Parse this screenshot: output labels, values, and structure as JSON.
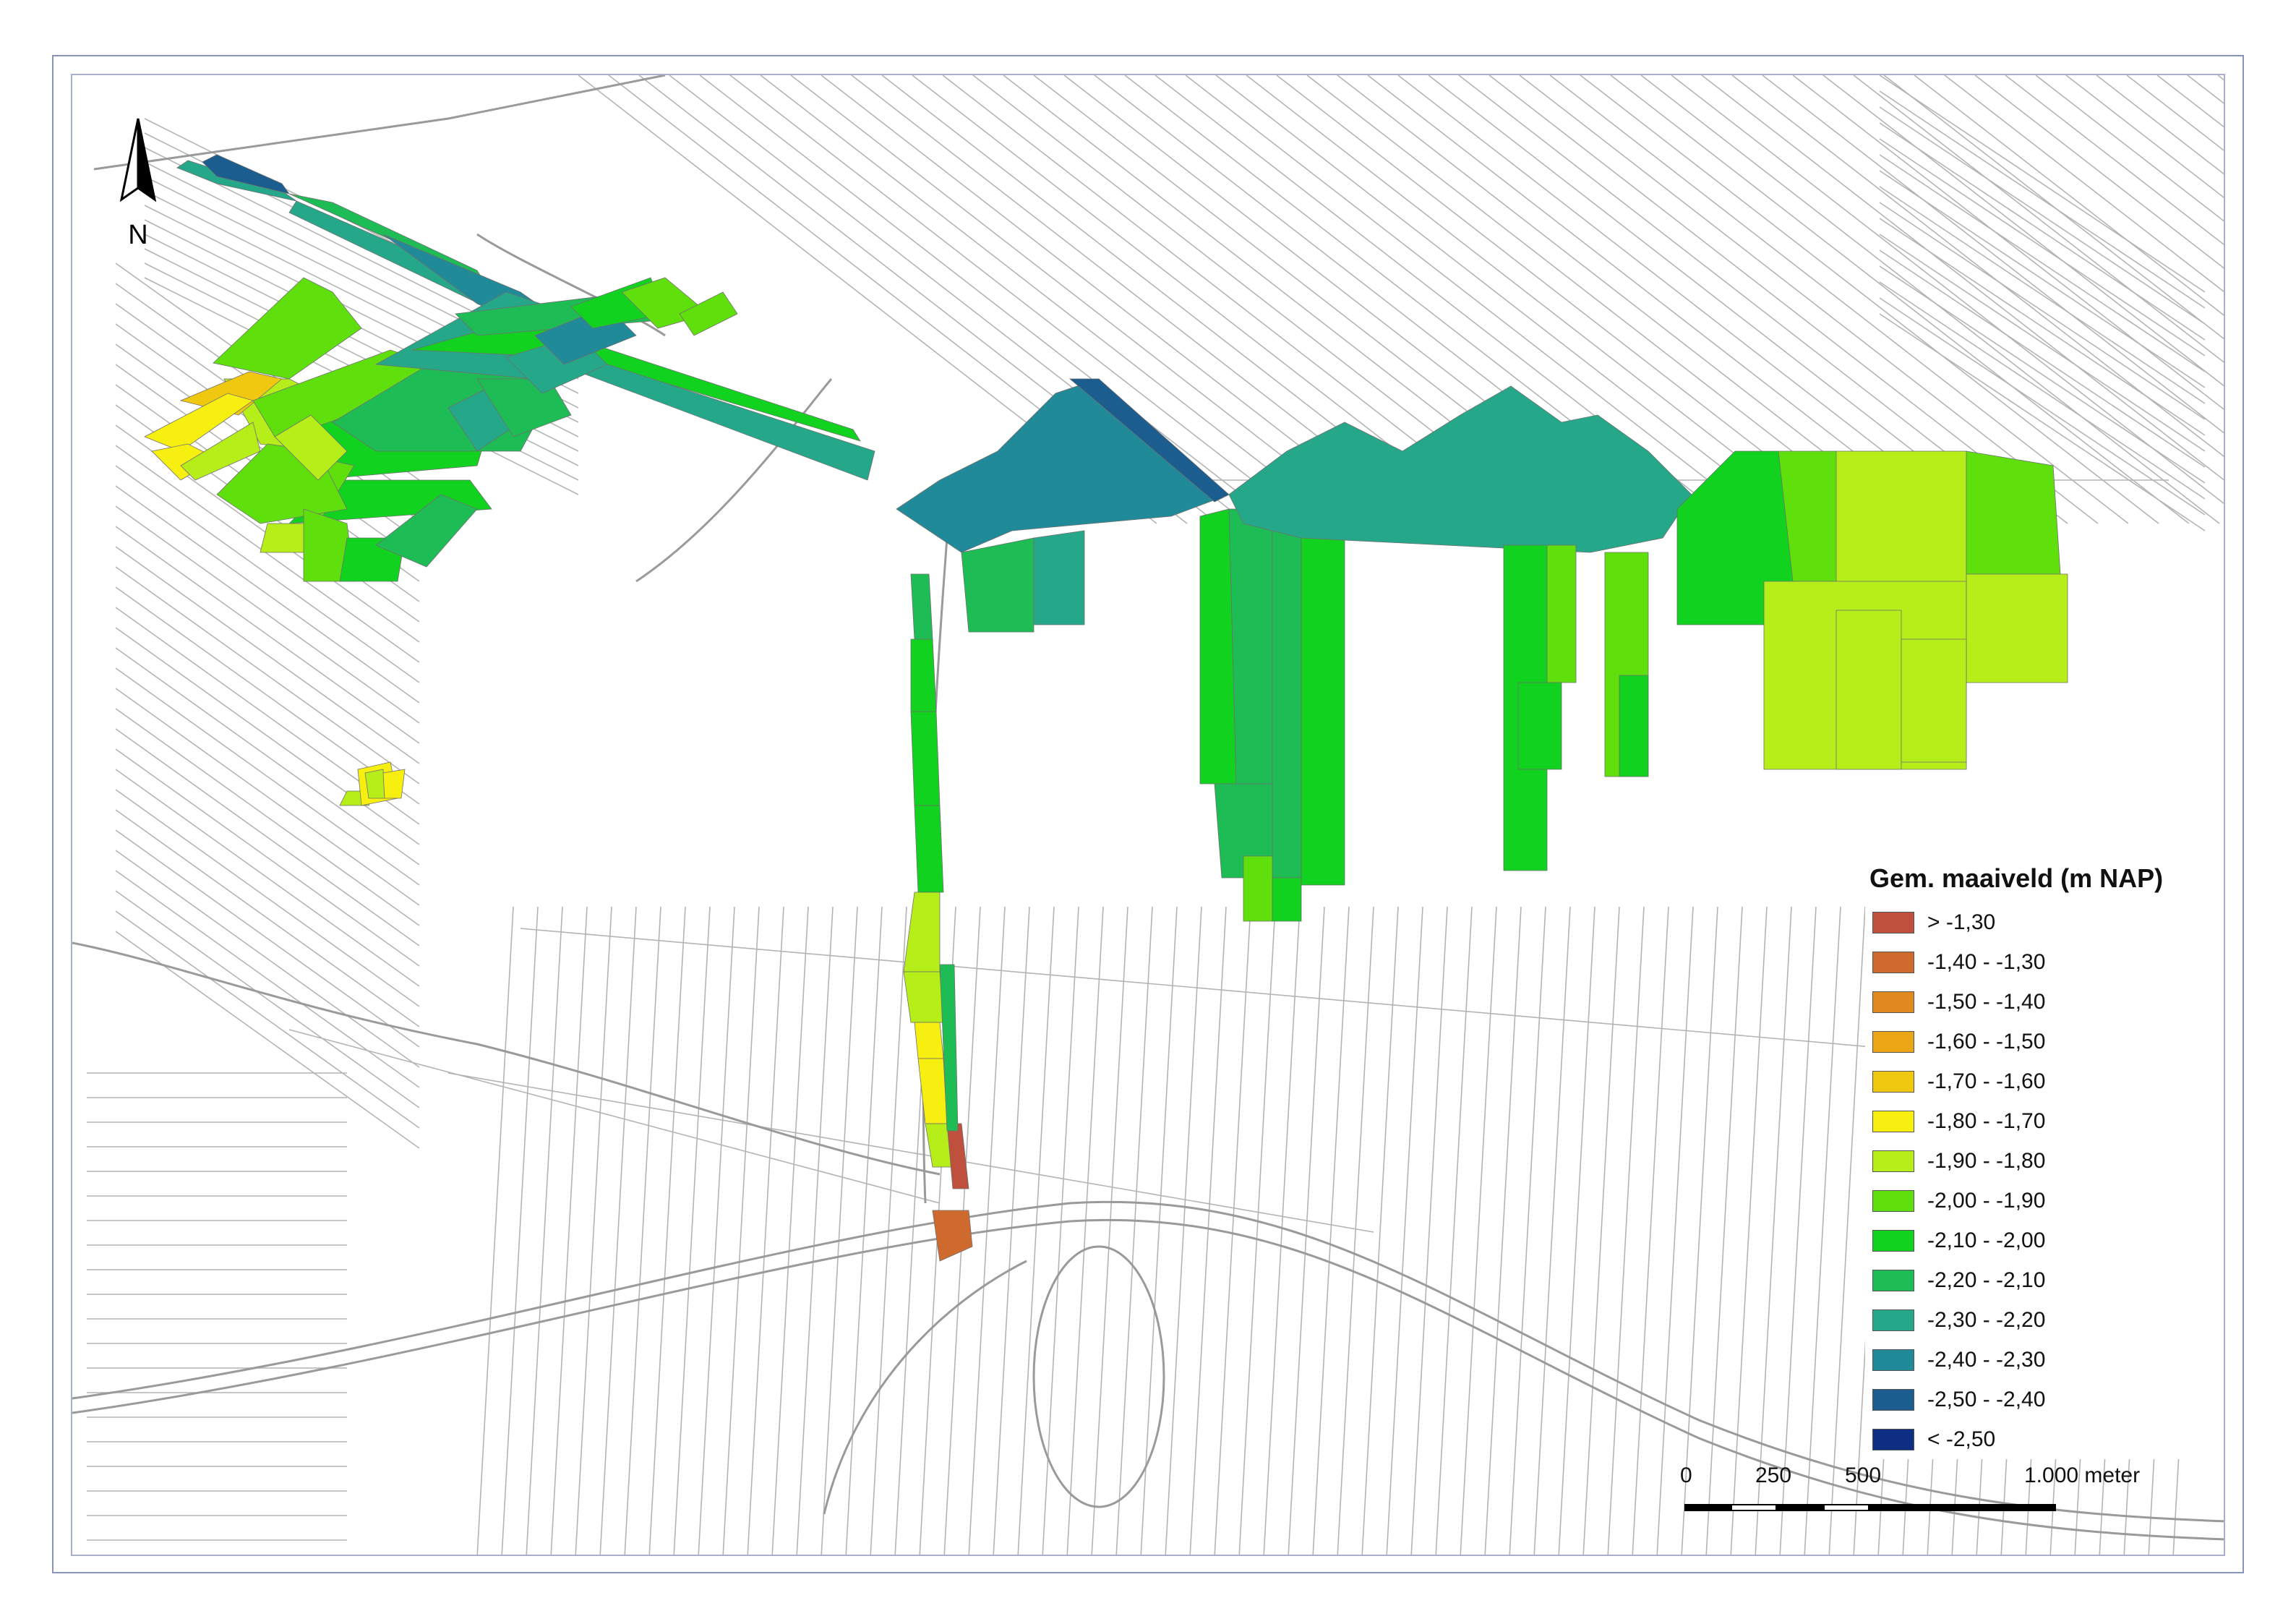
{
  "north_arrow": {
    "letter": "N",
    "icon": "north-arrow-icon"
  },
  "legend": {
    "title": "Gem. maaiveld (m NAP)",
    "classes": [
      {
        "label": "> -1,30",
        "color": "#c0503e"
      },
      {
        "label": "-1,40 - -1,30",
        "color": "#cf6a2e"
      },
      {
        "label": "-1,50 - -1,40",
        "color": "#e0891f"
      },
      {
        "label": "-1,60 - -1,50",
        "color": "#eaa615"
      },
      {
        "label": "-1,70 - -1,60",
        "color": "#f0c80f"
      },
      {
        "label": "-1,80 - -1,70",
        "color": "#f7ef10"
      },
      {
        "label": "-1,90 - -1,80",
        "color": "#b6ee1a"
      },
      {
        "label": "-2,00 - -1,90",
        "color": "#5fe00c"
      },
      {
        "label": "-2,10 - -2,00",
        "color": "#11d21f"
      },
      {
        "label": "-2,20 - -2,10",
        "color": "#1ebc55"
      },
      {
        "label": "-2,30 - -2,20",
        "color": "#25a88a"
      },
      {
        "label": "-2,40 - -2,30",
        "color": "#218a99"
      },
      {
        "label": "-2,50 - -2,40",
        "color": "#1a5d8e"
      },
      {
        "label": "< -2,50",
        "color": "#0e2e83"
      }
    ]
  },
  "scale_bar": {
    "labels": [
      "0",
      "250",
      "500",
      "1.000 meter"
    ],
    "values_m": [
      0,
      250,
      500,
      1000
    ]
  },
  "colors": {
    "frame": "#8a93b8",
    "parcel_outline": "#b4b4b4",
    "road": "#9a9a9a"
  }
}
